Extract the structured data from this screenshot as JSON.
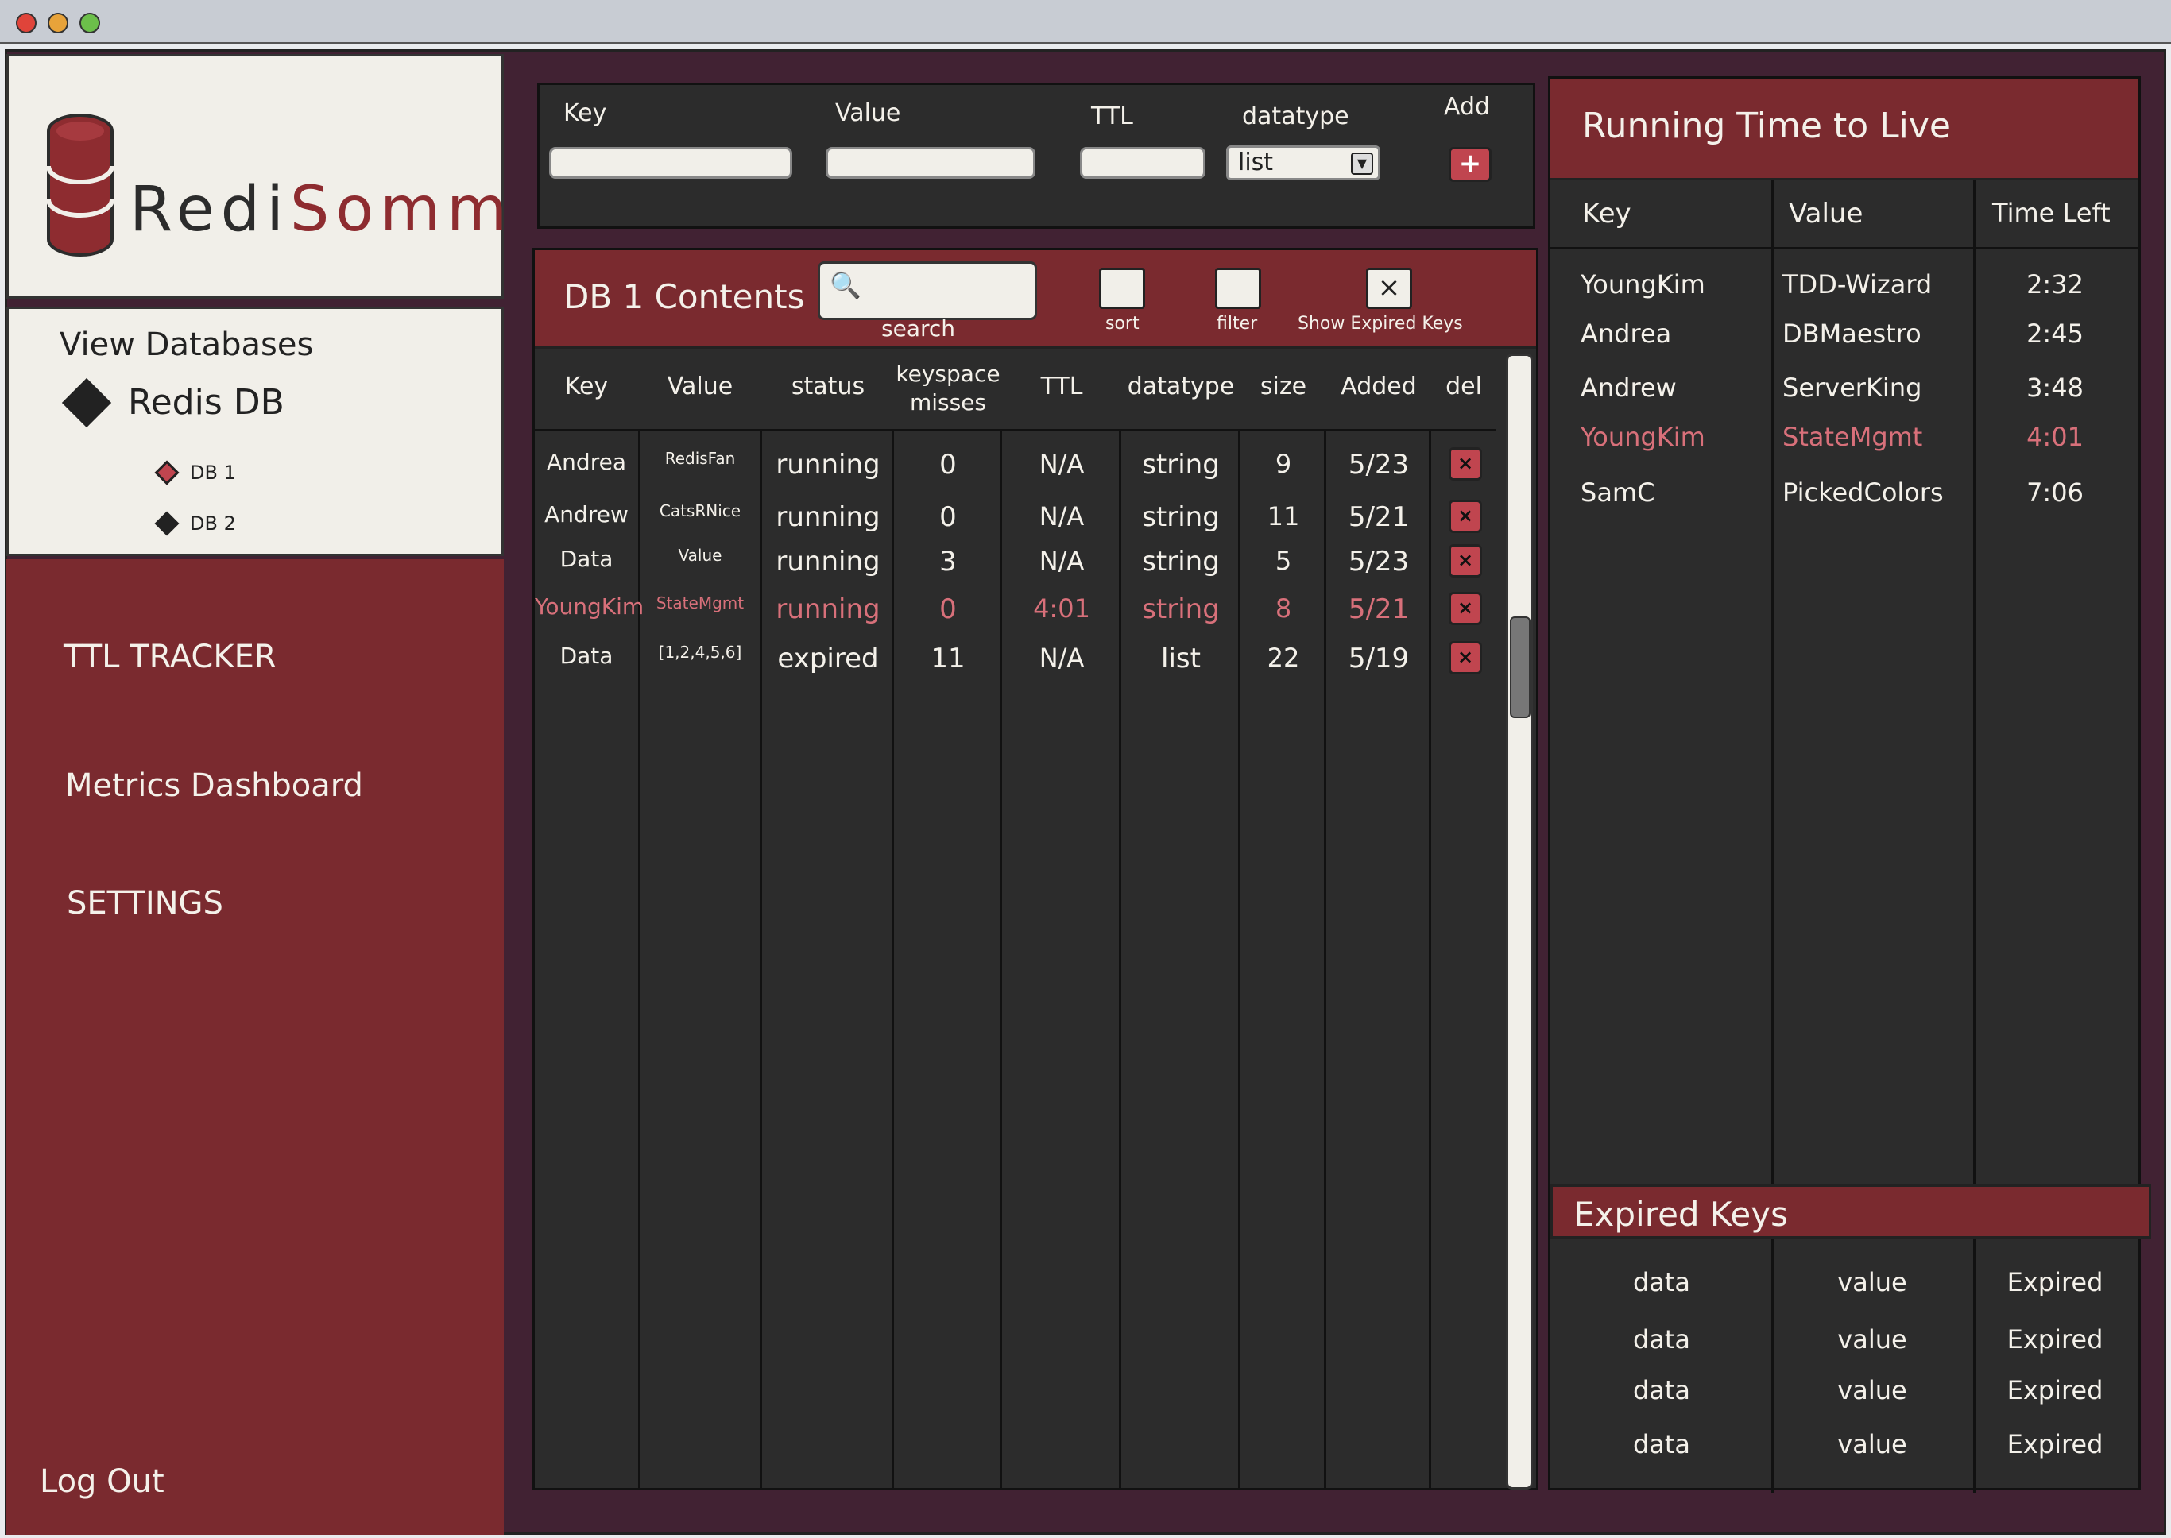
{
  "colors": {
    "accent": "#7a2a2f",
    "panel": "#2c2c2c",
    "background": "#412233",
    "highlight": "#d8707a"
  },
  "brand": {
    "name_part1": "Redi",
    "name_part2": "Somm"
  },
  "databases": {
    "title": "View Databases",
    "root": "Redis DB",
    "items": [
      {
        "label": "DB 1",
        "selected": true
      },
      {
        "label": "DB 2",
        "selected": false
      }
    ]
  },
  "nav": {
    "ttl": "TTL TRACKER",
    "metrics": "Metrics Dashboard",
    "settings": "SETTINGS",
    "logout": "Log Out"
  },
  "add_form": {
    "key_label": "Key",
    "value_label": "Value",
    "ttl_label": "TTL",
    "datatype_label": "datatype",
    "add_label": "Add",
    "datatype_value": "list",
    "add_icon": "+"
  },
  "contents": {
    "title": "DB 1 Contents",
    "search_label": "search",
    "sort_label": "sort",
    "filter_label": "filter",
    "show_expired_label": "Show Expired Keys",
    "show_expired_mark": "×",
    "columns": [
      "Key",
      "Value",
      "status",
      "keyspace misses",
      "TTL",
      "datatype",
      "size",
      "Added",
      "del"
    ],
    "rows": [
      {
        "key": "Andrea",
        "value": "RedisFan",
        "status": "running",
        "misses": "0",
        "ttl": "N/A",
        "datatype": "string",
        "size": "9",
        "added": "5/23",
        "highlight": false
      },
      {
        "key": "Andrew",
        "value": "CatsRNice",
        "status": "running",
        "misses": "0",
        "ttl": "N/A",
        "datatype": "string",
        "size": "11",
        "added": "5/21",
        "highlight": false
      },
      {
        "key": "Data",
        "value": "Value",
        "status": "running",
        "misses": "3",
        "ttl": "N/A",
        "datatype": "string",
        "size": "5",
        "added": "5/23",
        "highlight": false
      },
      {
        "key": "YoungKim",
        "value": "StateMgmt",
        "status": "running",
        "misses": "0",
        "ttl": "4:01",
        "datatype": "string",
        "size": "8",
        "added": "5/21",
        "highlight": true
      },
      {
        "key": "Data",
        "value": "[1,2,4,5,6]",
        "status": "expired",
        "misses": "11",
        "ttl": "N/A",
        "datatype": "list",
        "size": "22",
        "added": "5/19",
        "highlight": false
      }
    ]
  },
  "running_ttl": {
    "title": "Running Time to Live",
    "columns": [
      "Key",
      "Value",
      "Time Left"
    ],
    "rows": [
      {
        "key": "YoungKim",
        "value": "TDD-Wizard",
        "time": "2:32",
        "highlight": false
      },
      {
        "key": "Andrea",
        "value": "DBMaestro",
        "time": "2:45",
        "highlight": false
      },
      {
        "key": "Andrew",
        "value": "ServerKing",
        "time": "3:48",
        "highlight": false
      },
      {
        "key": "YoungKim",
        "value": "StateMgmt",
        "time": "4:01",
        "highlight": true
      },
      {
        "key": "SamC",
        "value": "PickedColors",
        "time": "7:06",
        "highlight": false
      }
    ]
  },
  "expired_keys": {
    "title": "Expired Keys",
    "rows": [
      {
        "key": "data",
        "value": "value",
        "status": "Expired"
      },
      {
        "key": "data",
        "value": "value",
        "status": "Expired"
      },
      {
        "key": "data",
        "value": "value",
        "status": "Expired"
      },
      {
        "key": "data",
        "value": "value",
        "status": "Expired"
      }
    ]
  }
}
